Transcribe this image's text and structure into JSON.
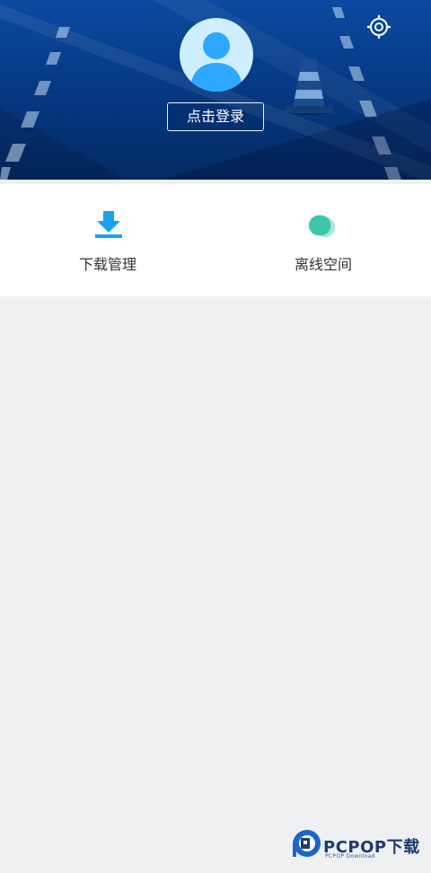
{
  "header": {
    "login_label": "点击登录",
    "settings_icon": "gear-icon",
    "avatar_icon": "user-avatar-icon",
    "colors": {
      "top": "#0b4aa0",
      "bottom": "#042a63",
      "avatar_bg": "#cfeeff",
      "avatar_fg": "#2ea8ff"
    }
  },
  "menu": {
    "items": [
      {
        "label": "下载管理",
        "icon": "download-icon",
        "color": "#19a3ef"
      },
      {
        "label": "离线空间",
        "icon": "cloud-icon",
        "color": "#3ec6ad"
      }
    ]
  },
  "watermark": {
    "brand": "PCPOP下载",
    "sub": "PCPOP Download"
  }
}
